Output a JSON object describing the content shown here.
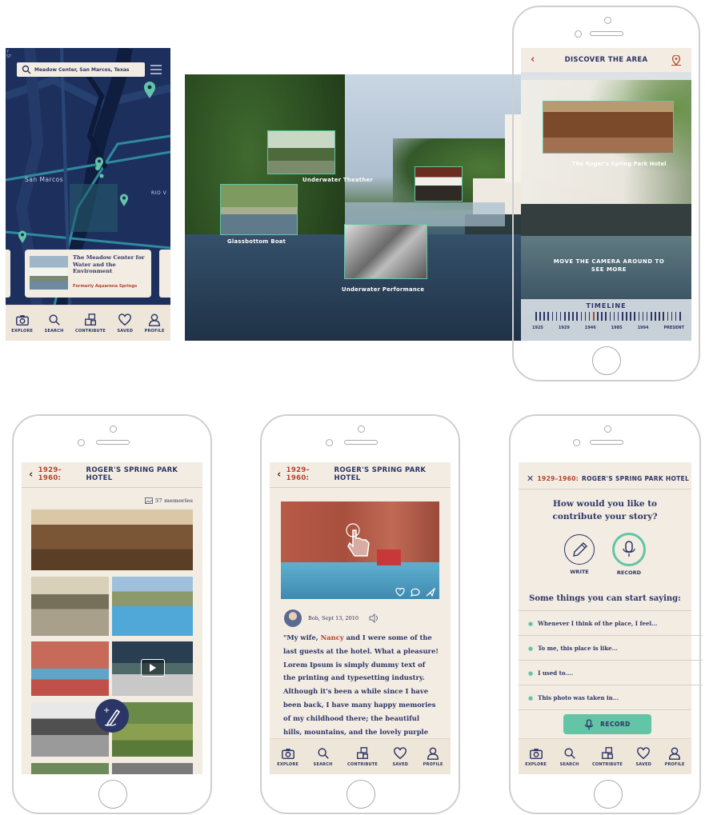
{
  "nav": {
    "explore": "EXPLORE",
    "search": "SEARCH",
    "contribute": "CONTRIBUTE",
    "saved": "SAVED",
    "profile": "PROFILE"
  },
  "map_screen": {
    "corner_label": "Y ST",
    "search_value": "Meadow Center, San Marcos, Texas",
    "city_label": "San Marcos",
    "road_label": "RIO V",
    "card_title": "The Meadow Center for Water and the Environment",
    "card_subtitle": "Formerly Aquarena Springs"
  },
  "ar_screen": {
    "labels": {
      "underwater_theater": "Underwater Theather",
      "glassbottom_boat": "Glassbottom Boat",
      "underwater_performance": "Underwater Performance",
      "rogers_hotel": "The Roger's Spring Park Hotel"
    },
    "header_title": "DISCOVER THE AREA",
    "hint": "MOVE THE CAMERA AROUND TO SEE MORE",
    "timeline_title": "TIMELINE",
    "timeline_years": [
      "1925",
      "1929",
      "1946",
      "1985",
      "1994",
      "PRESENT"
    ]
  },
  "gallery_screen": {
    "header_year": "1929–1960:",
    "header_title": "ROGER'S SPRING PARK HOTEL",
    "memories": "57 memories"
  },
  "story_screen": {
    "header_year": "1929–1960:",
    "header_title": "ROGER'S SPRING PARK HOTEL",
    "author_meta": "Bob, Sept 13, 2010",
    "story_p1": "\"My wife, ",
    "story_name": "Nancy",
    "story_p2": " and I were some of the last guests at the hotel. What a pleasure! Lorem Ipsum is simply dummy text of the printing and typesetting industry. Although it's been a while since I have been back, I have many happy memories of my childhood there; the beautiful hills, mountains, and the lovely purple heather there in front of"
  },
  "contribute_screen": {
    "header_year": "1929–1960:",
    "header_title": "ROGER'S SPRING PARK HOTEL",
    "question": "How would you like to contribute your story?",
    "write_label": "WRITE",
    "record_label": "RECORD",
    "prompts_title": "Some things you can start saying:",
    "prompts": [
      "Whenever I think of the place, I feel...",
      "To me, this place is like...",
      "I used to....",
      "This photo was taken in..."
    ],
    "record_button": "RECORD"
  },
  "colors": {
    "navy": "#2b3566",
    "rust": "#b4432d",
    "cream": "#f3ece2",
    "teal": "#63c4a6"
  }
}
